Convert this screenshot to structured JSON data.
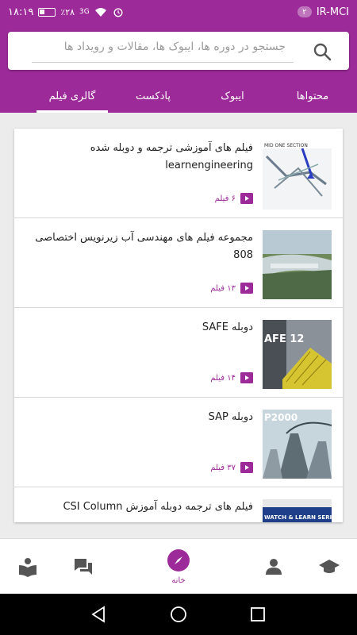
{
  "status_bar": {
    "carrier": "IR-MCI",
    "sim_badge": "۲",
    "battery_percent": "٪۲۸",
    "network": "3G",
    "time": "۱۸:۱۹"
  },
  "search": {
    "placeholder": "جستجو در دوره ها، ایبوک ها، مقالات و رویداد ها"
  },
  "tabs": [
    {
      "label": "محتواها",
      "active": false
    },
    {
      "label": "ایبوک",
      "active": false
    },
    {
      "label": "پادکست",
      "active": false
    },
    {
      "label": "گالری فیلم",
      "active": true
    }
  ],
  "cards": [
    {
      "title": "فیلم های آموزشی ترجمه و دوبله شده learnengineering",
      "count": "۶ فیلم",
      "thumb_text": "MID ONE SECTION"
    },
    {
      "title": "مجموعه فیلم های مهندسی آب زیرنویس اختصاصی 808",
      "count": "۱۳ فیلم",
      "thumb_text": ""
    },
    {
      "title": "دوبله SAFE",
      "count": "۱۴ فیلم",
      "thumb_text": "AFE 12"
    },
    {
      "title": "دوبله SAP",
      "count": "۳۷ فیلم",
      "thumb_text": "P2000"
    },
    {
      "title": "فیلم های ترجمه دوبله آموزش CSI Column",
      "count": "",
      "thumb_text": "WATCH & LEARN SERIES"
    }
  ],
  "bottom_nav": {
    "home_label": "خانه"
  },
  "colors": {
    "primary": "#9c2b99",
    "background": "#ececec"
  }
}
